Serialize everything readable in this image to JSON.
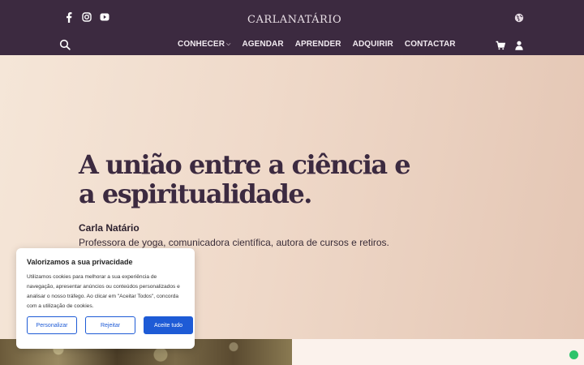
{
  "header": {
    "logo": {
      "left": "CARLA",
      "right": "NATÁRIO"
    },
    "nav": [
      {
        "label": "CONHECER",
        "has_dropdown": true
      },
      {
        "label": "AGENDAR"
      },
      {
        "label": "APRENDER"
      },
      {
        "label": "ADQUIRIR"
      },
      {
        "label": "CONTACTAR"
      }
    ],
    "icons": [
      "facebook-icon",
      "instagram-icon",
      "youtube-icon",
      "globe-icon",
      "search-icon",
      "cart-icon",
      "user-icon"
    ]
  },
  "hero": {
    "title": "A união entre a ciência e a espiritualidade.",
    "name": "Carla Natário",
    "subtitle": "Professora de yoga, comunicadora científica, autora de cursos e retiros."
  },
  "cookie": {
    "title": "Valorizamos a sua privacidade",
    "text": "Utilizamos cookies para melhorar a sua experiência de navegação, apresentar anúncios ou conteúdos personalizados e analisar o nosso tráfego. Ao clicar em \"Aceitar Todos\", concorda com a utilização de cookies.",
    "buttons": {
      "customize": "Personalizar",
      "reject": "Rejeitar",
      "accept": "Aceite tudo"
    }
  },
  "colors": {
    "header": "#3c2a40",
    "accent": "#1e5bd6",
    "whatsapp": "#2cc46b"
  }
}
